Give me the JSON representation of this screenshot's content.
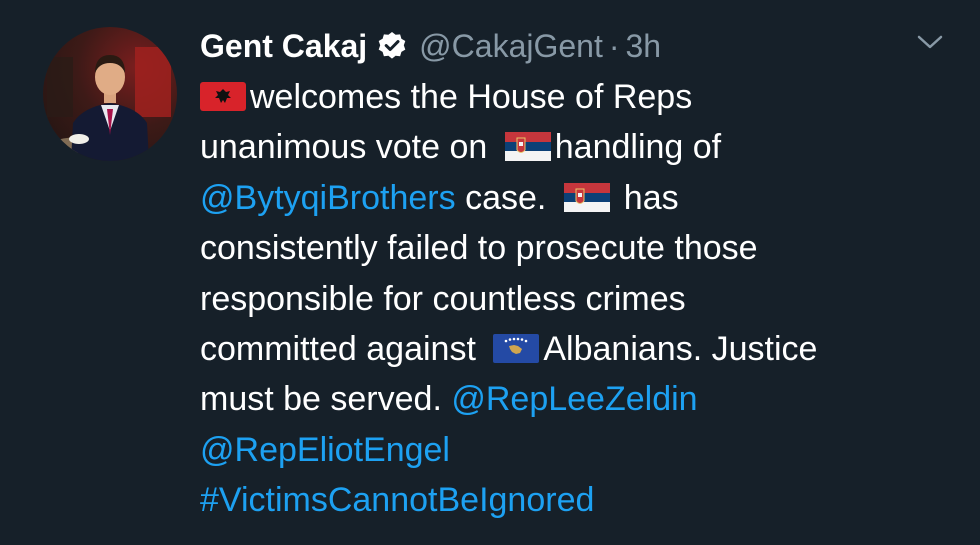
{
  "tweet": {
    "author": {
      "name": "Gent Cakaj",
      "handle": "@CakajGent",
      "verified_icon": "verified-badge-icon"
    },
    "separator": "·",
    "time": "3h",
    "menu_icon": "chevron-down-icon",
    "flags": {
      "albania": "albania-flag-icon",
      "serbia": "serbia-flag-icon",
      "kosovo": "kosovo-flag-icon"
    },
    "text": {
      "l1": "welcomes the House of Reps",
      "l2a": "unanimous vote on",
      "l2b": "handling of",
      "l3_mention": "@BytyqiBrothers",
      "l3a": "case.",
      "l3b": "has",
      "l4": "consistently failed to prosecute those",
      "l5": "responsible for countless crimes",
      "l6a": "committed against",
      "l6b": "Albanians. Justice",
      "l7a": "must be served.",
      "l7_mention": "@RepLeeZeldin",
      "l8_mention": "@RepEliotEngel",
      "l9_hashtag": "#VictimsCannotBeIgnored"
    }
  },
  "colors": {
    "background": "#162029",
    "text": "#ffffff",
    "secondary": "#8899a6",
    "link": "#1da1f2"
  }
}
